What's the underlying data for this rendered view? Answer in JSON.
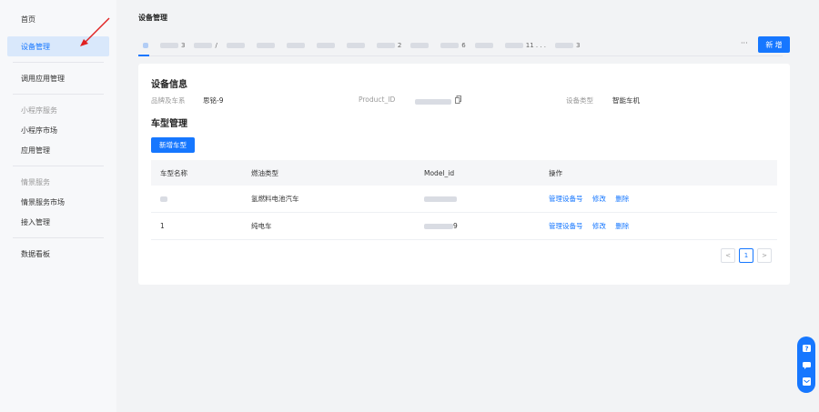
{
  "sidebar": {
    "items": [
      {
        "label": "首页"
      },
      {
        "label": "设备管理"
      },
      {
        "label": "调用应用管理"
      }
    ],
    "group_miniapp": "小程序服务",
    "miniapp_items": [
      {
        "label": "小程序市场"
      },
      {
        "label": "应用管理"
      }
    ],
    "group_scene": "情景服务",
    "scene_items": [
      {
        "label": "情景服务市场"
      },
      {
        "label": "接入管理"
      }
    ],
    "dashboard": "数据看板"
  },
  "header": {
    "title": "设备管理",
    "more": "···",
    "add_label": "新 增"
  },
  "tabs": [
    {
      "text": "",
      "w": 0
    },
    {
      "text": "3",
      "w": 14
    },
    {
      "text": "/",
      "w": 8
    },
    {
      "text": "",
      "w": 22
    },
    {
      "text": "",
      "w": 40
    },
    {
      "text": "",
      "w": 22
    },
    {
      "text": "",
      "w": 30
    },
    {
      "text": "",
      "w": 30
    },
    {
      "text": "2",
      "w": 30
    },
    {
      "text": "",
      "w": 30
    },
    {
      "text": "6",
      "w": 30
    },
    {
      "text": "",
      "w": 30
    },
    {
      "text": "11 . . .",
      "w": 14
    },
    {
      "text": "3",
      "w": 4
    }
  ],
  "device_info": {
    "title": "设备信息",
    "brand_label": "品牌及车系",
    "brand_value": "思铭-9",
    "product_label": "Product_ID",
    "type_label": "设备类型",
    "type_value": "智能车机"
  },
  "model_mgmt": {
    "title": "车型管理",
    "add_label": "新增车型",
    "columns": [
      "车型名称",
      "燃油类型",
      "Model_id",
      "操作"
    ],
    "rows": [
      {
        "name": "",
        "fuel": "氢燃料电池汽车",
        "model_id": "",
        "actions": [
          "管理设备号",
          "修改",
          "删除"
        ]
      },
      {
        "name": "1",
        "fuel": "纯电车",
        "model_id": "9",
        "actions": [
          "管理设备号",
          "修改",
          "删除"
        ]
      }
    ]
  },
  "pagination": {
    "prev": "<",
    "current": "1",
    "next": ">"
  },
  "colors": {
    "accent": "#1677ff"
  }
}
